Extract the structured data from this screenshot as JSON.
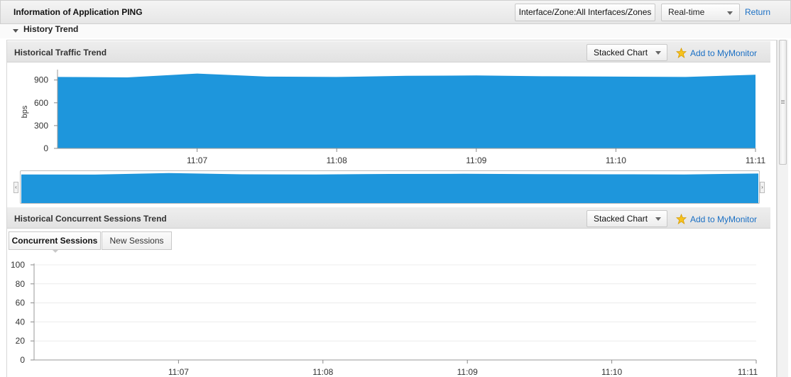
{
  "header": {
    "title": "Information of Application PING",
    "interface_zone": "Interface/Zone:All Interfaces/Zones",
    "time_mode": "Real-time",
    "return_label": "Return"
  },
  "history": {
    "label": "History Trend"
  },
  "traffic_section": {
    "title": "Historical Traffic Trend",
    "chart_mode": "Stacked Chart",
    "add_monitor": "Add to MyMonitor"
  },
  "sessions_section": {
    "title": "Historical Concurrent Sessions Trend",
    "chart_mode": "Stacked Chart",
    "add_monitor": "Add to MyMonitor",
    "tabs": [
      "Concurrent Sessions",
      "New Sessions"
    ],
    "active_tab": "Concurrent Sessions"
  },
  "icons": {
    "star": "star-icon",
    "caret": "chevron-down-icon",
    "collapse": "triangle-down-icon"
  },
  "colors": {
    "area_fill": "#1e96dc",
    "link": "#1a6fc4"
  },
  "chart_data": [
    {
      "type": "area",
      "title": "Historical Traffic Trend",
      "xlabel": "",
      "ylabel": "bps",
      "ylim": [
        0,
        1000
      ],
      "yticks": [
        0,
        300,
        600,
        900
      ],
      "xticks": [
        "11:07",
        "11:08",
        "11:09",
        "11:10",
        "11:11"
      ],
      "x": [
        "11:06:00",
        "11:06:30",
        "11:07:00",
        "11:07:30",
        "11:08:00",
        "11:08:30",
        "11:09:00",
        "11:09:30",
        "11:10:00",
        "11:10:30",
        "11:11:00"
      ],
      "series": [
        {
          "values": [
            940,
            935,
            985,
            945,
            940,
            955,
            960,
            950,
            945,
            940,
            970
          ]
        }
      ],
      "grid": false
    },
    {
      "type": "area",
      "title": "Historical Concurrent Sessions Trend",
      "xlabel": "",
      "ylabel": "",
      "ylim": [
        0,
        100
      ],
      "yticks": [
        0,
        20,
        40,
        60,
        80,
        100
      ],
      "xticks": [
        "11:07",
        "11:08",
        "11:09",
        "11:10",
        "11:11"
      ],
      "x": [],
      "series": [],
      "grid": true
    }
  ]
}
